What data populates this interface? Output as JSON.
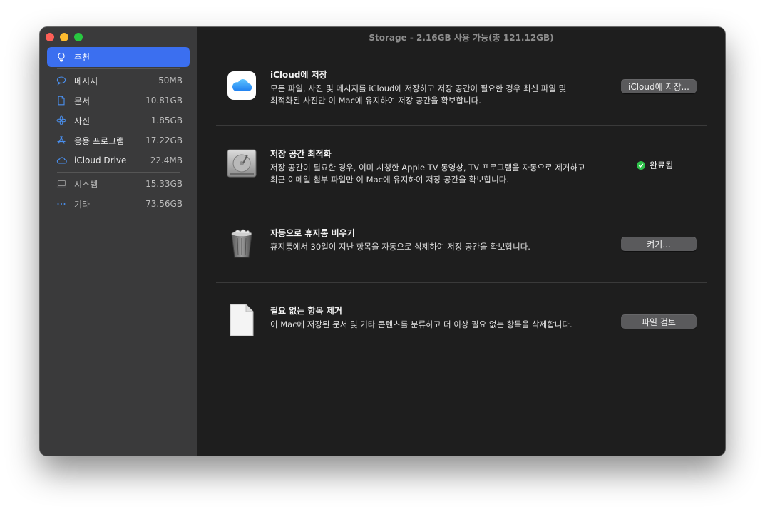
{
  "window": {
    "title": "Storage - 2.16GB 사용 가능(총 121.12GB)"
  },
  "sidebar": {
    "items": [
      {
        "label": "추천",
        "size": "",
        "icon": "lightbulb-icon",
        "active": true
      },
      {
        "label": "메시지",
        "size": "50MB",
        "icon": "message-bubble-icon"
      },
      {
        "label": "문서",
        "size": "10.81GB",
        "icon": "document-icon"
      },
      {
        "label": "사진",
        "size": "1.85GB",
        "icon": "photos-flower-icon"
      },
      {
        "label": "응용 프로그램",
        "size": "17.22GB",
        "icon": "app-store-icon"
      },
      {
        "label": "iCloud Drive",
        "size": "22.4MB",
        "icon": "cloud-icon"
      },
      {
        "label": "시스템",
        "size": "15.33GB",
        "icon": "laptop-icon"
      },
      {
        "label": "기타",
        "size": "73.56GB",
        "icon": "ellipsis-icon"
      }
    ]
  },
  "recommendations": [
    {
      "title": "iCloud에 저장",
      "desc_line1": "모든 파일, 사진 및 메시지를 iCloud에 저장하고 저장 공간이 필요한 경우 최신 파일 및",
      "desc_line2": "최적화된 사진만 이 Mac에 유지하여 저장 공간을 확보합니다.",
      "action_label": "iCloud에 저장...",
      "icon": "icloud-icon"
    },
    {
      "title": "저장 공간 최적화",
      "desc_line1": "저장 공간이 필요한 경우, 이미 시청한 Apple TV 동영상, TV 프로그램을 자동으로 제거하고",
      "desc_line2": "최근 이메일 첨부 파일만 이 Mac에 유지하여 저장 공간을 확보합니다.",
      "status_label": "완료됨",
      "icon": "hard-drive-icon"
    },
    {
      "title": "자동으로 휴지통 비우기",
      "desc_line1": "휴지통에서 30일이 지난 항목을 자동으로 삭제하여 저장 공간을 확보합니다.",
      "action_label": "켜기...",
      "icon": "trash-icon"
    },
    {
      "title": "필요 없는 항목 제거",
      "desc_line1": "이 Mac에 저장된 문서 및 기타 콘텐츠를 분류하고 더 이상 필요 없는 항목을 삭제합니다.",
      "action_label": "파일 검토",
      "icon": "blank-document-icon"
    }
  ],
  "colors": {
    "accent": "#3b6ff0",
    "sidebar_bg": "#3a3a3b",
    "main_bg": "#1e1e1e",
    "status_green": "#2ec14a"
  }
}
